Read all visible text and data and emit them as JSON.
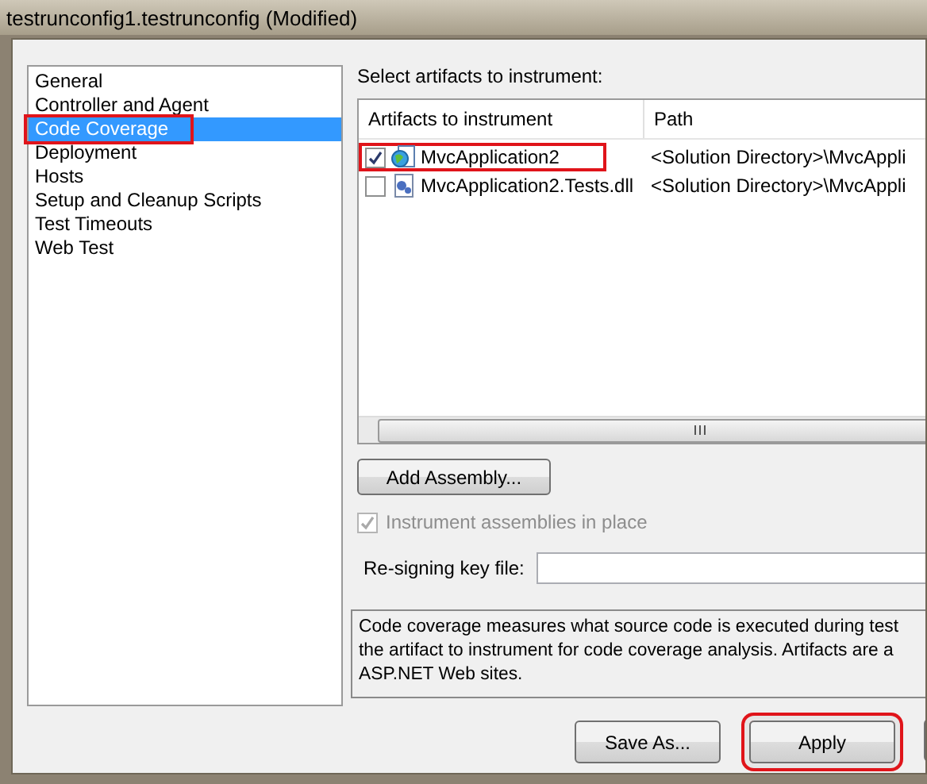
{
  "window": {
    "title": "testrunconfig1.testrunconfig (Modified)"
  },
  "sidebar": {
    "items": [
      {
        "label": "General",
        "selected": false,
        "highlighted": false
      },
      {
        "label": "Controller and Agent",
        "selected": false,
        "highlighted": false
      },
      {
        "label": "Code Coverage",
        "selected": true,
        "highlighted": true
      },
      {
        "label": "Deployment",
        "selected": false,
        "highlighted": false
      },
      {
        "label": "Hosts",
        "selected": false,
        "highlighted": false
      },
      {
        "label": "Setup and Cleanup Scripts",
        "selected": false,
        "highlighted": false
      },
      {
        "label": "Test Timeouts",
        "selected": false,
        "highlighted": false
      },
      {
        "label": "Web Test",
        "selected": false,
        "highlighted": false
      }
    ]
  },
  "artifacts": {
    "label": "Select artifacts to instrument:",
    "columns": [
      "Artifacts to instrument",
      "Path"
    ],
    "rows": [
      {
        "name": "MvcApplication2",
        "path": "<Solution Directory>\\MvcAppli",
        "checked": true,
        "highlighted": true,
        "kind": "web"
      },
      {
        "name": "MvcApplication2.Tests.dll",
        "path": "<Solution Directory>\\MvcAppli",
        "checked": false,
        "highlighted": false,
        "kind": "dll"
      }
    ]
  },
  "add_button": "Add Assembly...",
  "instrument_in_place": {
    "label": "Instrument assemblies in place",
    "checked": true,
    "disabled": true
  },
  "resigning": {
    "label": "Re-signing key file:"
  },
  "description": [
    "Code coverage measures what source code is executed during test",
    "the artifact to instrument for code coverage analysis. Artifacts are a",
    "ASP.NET Web sites."
  ],
  "buttons": [
    {
      "label": "Save As...",
      "highlighted": false
    },
    {
      "label": "Apply",
      "highlighted": true
    },
    {
      "highlighted": false
    }
  ]
}
